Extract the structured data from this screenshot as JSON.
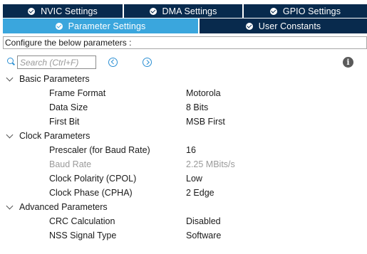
{
  "tabs_row1": [
    {
      "label": "NVIC Settings"
    },
    {
      "label": "DMA Settings"
    },
    {
      "label": "GPIO Settings"
    }
  ],
  "tabs_row2": [
    {
      "label": "Parameter Settings",
      "active": true
    },
    {
      "label": "User Constants"
    }
  ],
  "config_bar": {
    "text": "Configure the below parameters :"
  },
  "search": {
    "placeholder": "Search (Ctrl+F)"
  },
  "icons": {
    "search": "search-icon",
    "prev": "chevron-left-icon",
    "next": "chevron-right-icon",
    "info": "info-icon"
  },
  "info": {
    "glyph": "i"
  },
  "groups": [
    {
      "title": "Basic Parameters",
      "params": [
        {
          "name": "Frame Format",
          "value": "Motorola"
        },
        {
          "name": "Data Size",
          "value": "8 Bits"
        },
        {
          "name": "First Bit",
          "value": "MSB First"
        }
      ]
    },
    {
      "title": "Clock Parameters",
      "params": [
        {
          "name": "Prescaler (for Baud Rate)",
          "value": "16"
        },
        {
          "name": "Baud Rate",
          "value": "2.25 MBits/s",
          "disabled": true
        },
        {
          "name": "Clock Polarity (CPOL)",
          "value": "Low"
        },
        {
          "name": "Clock Phase (CPHA)",
          "value": "2 Edge"
        }
      ]
    },
    {
      "title": "Advanced Parameters",
      "params": [
        {
          "name": "CRC Calculation",
          "value": "Disabled"
        },
        {
          "name": "NSS Signal Type",
          "value": "Software"
        }
      ]
    }
  ],
  "colors": {
    "tab_bg": "#082a4d",
    "tab_active_bg": "#3aa6dd",
    "accent": "#2b8fd3",
    "disabled_text": "#9a9a9a"
  }
}
